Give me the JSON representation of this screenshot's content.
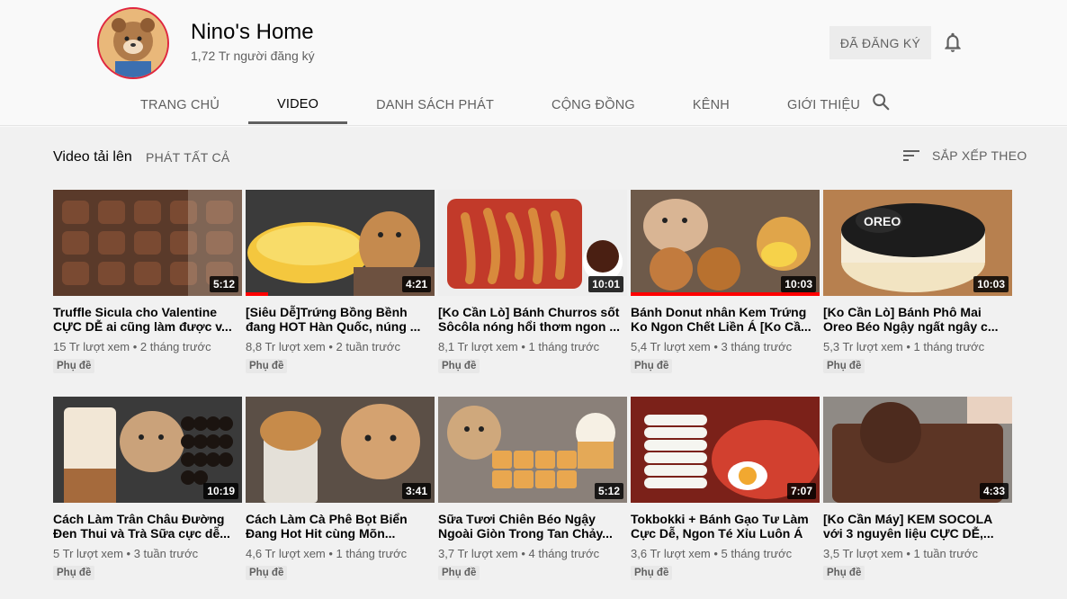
{
  "channel": {
    "name": "Nino's Home",
    "subscribers": "1,72 Tr người đăng ký",
    "subscribe_label": "ĐÃ ĐĂNG KÝ",
    "bell_icon": "bell-icon"
  },
  "tabs": [
    {
      "label": "TRANG CHỦ"
    },
    {
      "label": "VIDEO",
      "active": true
    },
    {
      "label": "DANH SÁCH PHÁT"
    },
    {
      "label": "CỘNG ĐỒNG"
    },
    {
      "label": "KÊNH"
    },
    {
      "label": "GIỚI THIỆU"
    }
  ],
  "section": {
    "title": "Video tải lên",
    "play_all": "PHÁT TẤT CẢ",
    "sort_label": "SẮP XẾP THEO"
  },
  "videos": [
    {
      "title": "Truffle Sicula cho Valentine CỰC DỄ ai cũng làm được v...",
      "duration": "5:12",
      "views": "15 Tr lượt xem",
      "age": "2 tháng trước",
      "badge": "Phụ đề",
      "watched": 0,
      "theme": "truffle"
    },
    {
      "title": "[Siêu Dễ]Trứng Bồng Bềnh đang HOT Hàn Quốc, núng ...",
      "duration": "4:21",
      "views": "8,8 Tr lượt xem",
      "age": "2 tuần trước",
      "badge": "Phụ đề",
      "watched": 0.12,
      "theme": "omelette"
    },
    {
      "title": "[Ko Cần Lò] Bánh Churros sốt Sôcôla nóng hổi thơm ngon ...",
      "duration": "10:01",
      "views": "8,1 Tr lượt xem",
      "age": "1 tháng trước",
      "badge": "Phụ đề",
      "watched": 0,
      "theme": "churros"
    },
    {
      "title": "Bánh Donut nhân Kem Trứng Ko Ngon Chết Liền Á [Ko Cầ...",
      "duration": "10:03",
      "views": "5,4 Tr lượt xem",
      "age": "3 tháng trước",
      "badge": "Phụ đề",
      "watched": 1,
      "theme": "donut"
    },
    {
      "title": "[Ko Cần Lò] Bánh Phô Mai Oreo Béo Ngậy ngất ngây c...",
      "duration": "10:03",
      "views": "5,3 Tr lượt xem",
      "age": "1 tháng trước",
      "badge": "Phụ đề",
      "watched": 0,
      "theme": "oreo"
    },
    {
      "title": "Cách Làm Trân Châu Đường Đen Thui và Trà Sữa cực dễ...",
      "duration": "10:19",
      "views": "5 Tr lượt xem",
      "age": "3 tuần trước",
      "badge": "Phụ đề",
      "watched": 0,
      "theme": "boba"
    },
    {
      "title": "Cách Làm Cà Phê Bọt Biển Đang Hot Hit cùng Mõn...",
      "duration": "3:41",
      "views": "4,6 Tr lượt xem",
      "age": "1 tháng trước",
      "badge": "Phụ đề",
      "watched": 0,
      "theme": "coffee"
    },
    {
      "title": "Sữa Tươi Chiên Béo Ngậy Ngoài Giòn Trong Tan Chảy...",
      "duration": "5:12",
      "views": "3,7 Tr lượt xem",
      "age": "4 tháng trước",
      "badge": "Phụ đề",
      "watched": 0,
      "theme": "milk"
    },
    {
      "title": "Tokbokki + Bánh Gạo Tư Làm Cực Dễ, Ngon Té Xỉu Luôn Á",
      "duration": "7:07",
      "views": "3,6 Tr lượt xem",
      "age": "5 tháng trước",
      "badge": "Phụ đề",
      "watched": 0,
      "theme": "tokbokki"
    },
    {
      "title": "[Ko Cần Máy] KEM SOCOLA với 3 nguyên liệu CỰC DỄ,...",
      "duration": "4:33",
      "views": "3,5 Tr lượt xem",
      "age": "1 tuần trước",
      "badge": "Phụ đề",
      "watched": 0,
      "theme": "icecream"
    }
  ],
  "colors": {
    "accent": "#ff0000",
    "text_secondary": "#606060"
  }
}
